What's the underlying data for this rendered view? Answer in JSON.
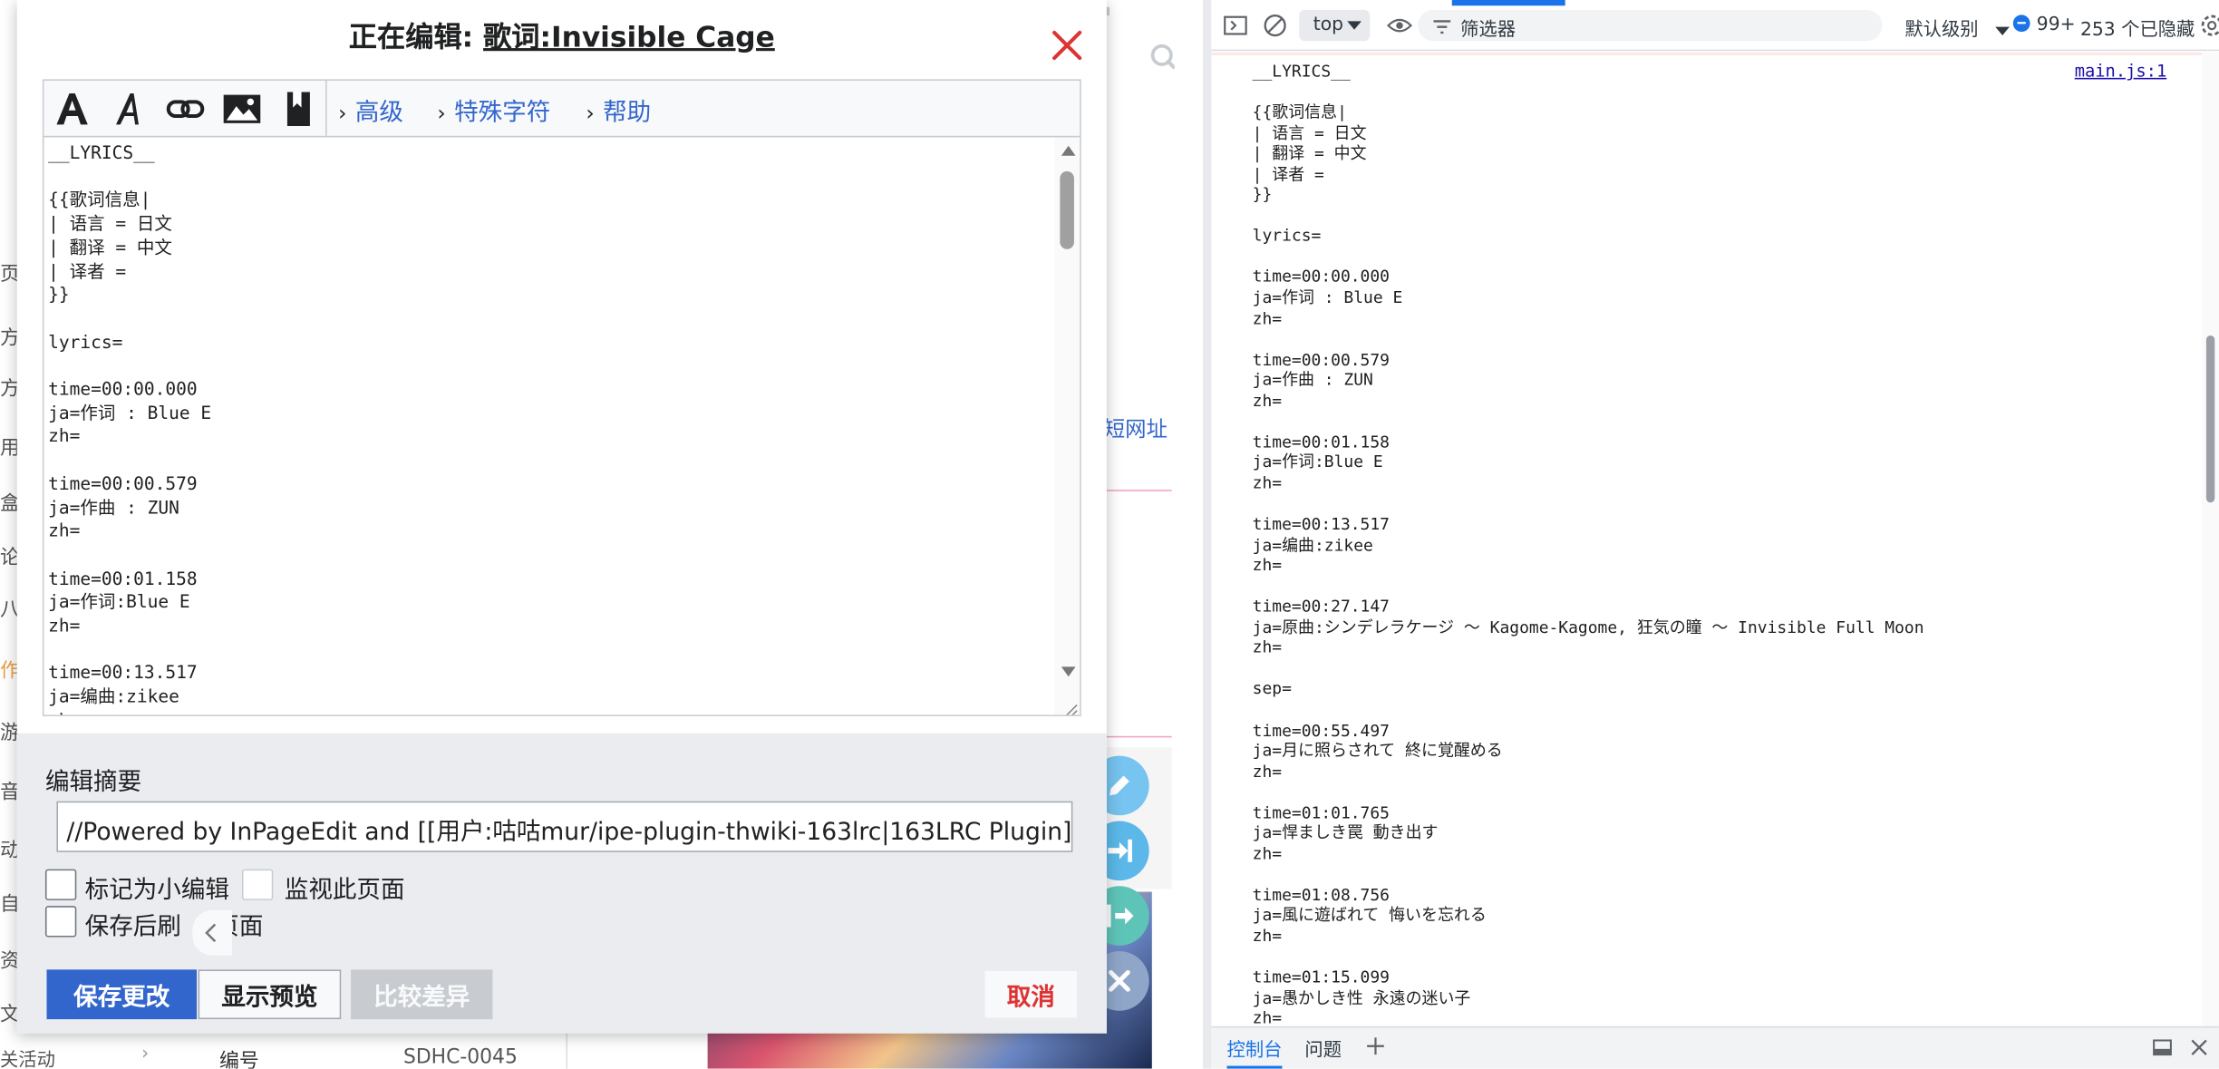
{
  "dialog": {
    "title_prefix": "正在编辑: ",
    "page_name": "歌词:Invisible Cage",
    "toolbar": {
      "advanced": "高级",
      "special_chars": "特殊字符",
      "help": "帮助"
    },
    "editor_text": "__LYRICS__\n\n{{歌词信息|\n| 语言 = 日文\n| 翻译 = 中文\n| 译者 =\n}}\n\nlyrics=\n\ntime=00:00.000\nja=作词 : Blue E\nzh=\n\ntime=00:00.579\nja=作曲 : ZUN\nzh=\n\ntime=00:01.158\nja=作词:Blue E\nzh=\n\ntime=00:13.517\nja=编曲:zikee\nzh=",
    "summary_label": "编辑摘要",
    "summary_value": "//Powered by InPageEdit and [[用户:咕咕mur/ipe-plugin-thwiki-163lrc|163LRC Plugin]]",
    "minor_edit_label": "标记为小编辑",
    "watch_label": "监视此页面",
    "reload_label_start": "保存后刷",
    "reload_label_end": "页面",
    "buttons": {
      "save": "保存更改",
      "preview": "显示预览",
      "diff": "比较差异",
      "cancel": "取消"
    }
  },
  "background": {
    "short_url": "短网址",
    "left_fragments": [
      "页",
      "方向",
      "方向",
      "用",
      "盒",
      "论",
      "八",
      "作",
      "游",
      "音乐",
      "动",
      "自",
      "资",
      "文"
    ],
    "left_last": "关活动",
    "table_key": "编号",
    "table_value": "SDHC-0045"
  },
  "devtools": {
    "top_context": "top",
    "filter_placeholder": "筛选器",
    "level": "默认级别",
    "issues_count": "99+",
    "hidden_count": "253 个已隐藏",
    "source_link": "main.js:1",
    "log_text": "__LYRICS__\n\n{{歌词信息|\n| 语言 = 日文\n| 翻译 = 中文\n| 译者 =\n}}\n\nlyrics=\n\ntime=00:00.000\nja=作词 : Blue E\nzh=\n\ntime=00:00.579\nja=作曲 : ZUN\nzh=\n\ntime=00:01.158\nja=作词:Blue E\nzh=\n\ntime=00:13.517\nja=编曲:zikee\nzh=\n\ntime=00:27.147\nja=原曲:シンデレラケージ ～ Kagome-Kagome, 狂気の瞳 ～ Invisible Full Moon\nzh=\n\nsep=\n\ntime=00:55.497\nja=月に照らされて 終に覚醒める\nzh=\n\ntime=01:01.765\nja=悍ましき罠 動き出す\nzh=\n\ntime=01:08.756\nja=風に遊ばれて 悔いを忘れる\nzh=\n\ntime=01:15.099\nja=愚かしき性 永遠の迷い子\nzh=",
    "tabs": {
      "console": "控制台",
      "issues": "问题"
    }
  },
  "colors": {
    "accent": "#3366cc",
    "danger": "#dd3333",
    "devtools_blue": "#1a73e8"
  }
}
